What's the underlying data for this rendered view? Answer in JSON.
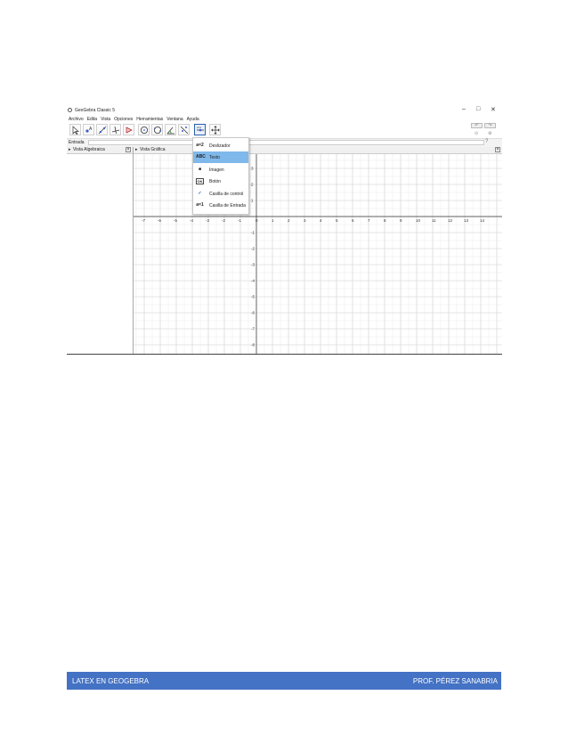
{
  "app": {
    "title": "GeoGebra Classic 5"
  },
  "window_controls": {
    "minimize": "–",
    "maximize": "□",
    "close": "✕"
  },
  "menu": [
    "Archivo",
    "Edita",
    "Vista",
    "Opciones",
    "Herramientas",
    "Ventana",
    "Ayuda"
  ],
  "toolbar": {
    "tools": [
      "move-tool",
      "point-tool",
      "line-tool",
      "perpendicular-tool",
      "polygon-tool",
      "circle-tool",
      "circle-arc-tool",
      "angle-tool",
      "reflect-tool",
      "slider-tool",
      "move-view-tool"
    ],
    "active_index": 9,
    "undo": "↶",
    "redo": "↷"
  },
  "input_bar": {
    "label": "Entrada",
    "help": "?"
  },
  "views": {
    "algebra": "Vista Algebraica",
    "graphics": "Vista Gráfica"
  },
  "dropdown": {
    "items": [
      {
        "icon": "a=2",
        "label": "Deslizador"
      },
      {
        "icon": "ABC",
        "label": "Texto"
      },
      {
        "icon": "■",
        "label": "Imagen"
      },
      {
        "icon": "OK",
        "label": "Botón"
      },
      {
        "icon": "✓",
        "label": "Casilla de control"
      },
      {
        "icon": "a=1",
        "label": "Casilla de Entrada"
      }
    ],
    "selected": "Texto"
  },
  "axes": {
    "x_ticks": [
      -7,
      -6,
      -5,
      -4,
      -3,
      -2,
      -1,
      0,
      1,
      2,
      3,
      4,
      5,
      6,
      7,
      8,
      9,
      10,
      11,
      12,
      13,
      14
    ],
    "y_ticks": [
      4,
      3,
      2,
      1,
      -1,
      -2,
      -3,
      -4,
      -5,
      -6,
      -7,
      -8
    ]
  },
  "footer": {
    "left": "LATEX EN GEOGEBRA",
    "right": "PROF. PÉREZ SANABRIA"
  },
  "colors": {
    "footer": "#4472c4",
    "selected_item": "#7fb8ea",
    "active_tool": "#2b5fae"
  }
}
